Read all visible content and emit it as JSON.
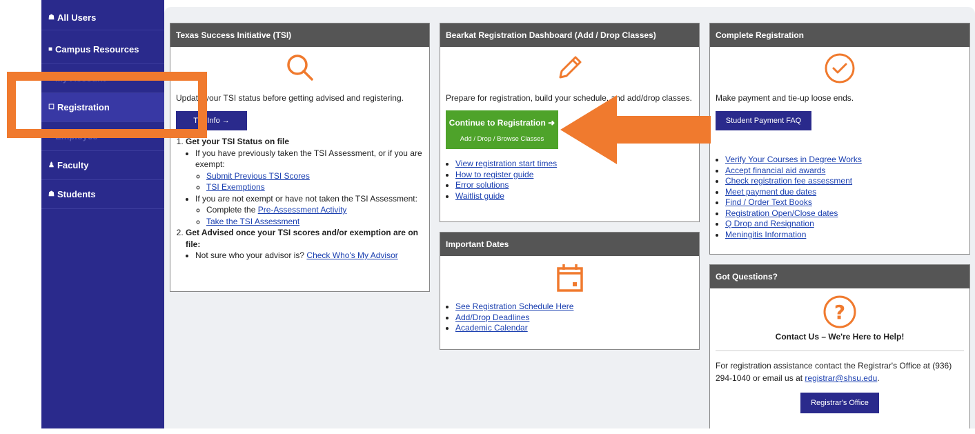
{
  "sidebar": {
    "items": [
      {
        "icon": "users-icon",
        "glyph": "☗",
        "label": "All Users"
      },
      {
        "icon": "folder-icon",
        "glyph": "■",
        "label": "Campus Resources"
      },
      {
        "icon": "user-icon",
        "glyph": "■",
        "label": "My Account"
      },
      {
        "icon": "edit-icon",
        "glyph": "☐",
        "label": "Registration"
      },
      {
        "icon": "calendar-icon",
        "glyph": "■",
        "label": "Employee"
      },
      {
        "icon": "faculty-icon",
        "glyph": "♟",
        "label": "Faculty"
      },
      {
        "icon": "students-icon",
        "glyph": "☗",
        "label": "Students"
      }
    ]
  },
  "tsi": {
    "title": "Texas Success Initiative (TSI)",
    "intro": "Update your TSI status before getting advised and registering.",
    "button": "TSI Info →",
    "step1_title": "Get your TSI Status on file",
    "step1_a": "If you have previously taken the TSI Assessment, or if you are exempt:",
    "link_submit": "Submit Previous TSI Scores",
    "link_exemptions": "TSI Exemptions",
    "step1_b": "If you are not exempt or have not taken the TSI Assessment:",
    "complete_the": "Complete the ",
    "link_pre": "Pre-Assessment Activity",
    "link_take": "Take the TSI Assessment",
    "step2_title": "Get Advised once your TSI scores and/or exemption are on file:",
    "advisor_text": "Not sure who your advisor is? ",
    "link_advisor": "Check Who's My Advisor"
  },
  "dashboard": {
    "title": "Bearkat Registration Dashboard (Add / Drop Classes)",
    "intro": "Prepare for registration, build your schedule, and add/drop classes.",
    "button_main": "Continue to Registration ➜",
    "button_sub": "Add / Drop / Browse Classes",
    "links": [
      "View registration start times",
      "How to register guide",
      "Error solutions",
      "Waitlist guide"
    ]
  },
  "dates": {
    "title": "Important Dates",
    "links": [
      "See Registration Schedule Here",
      "Add/Drop Deadlines",
      "Academic Calendar"
    ]
  },
  "complete": {
    "title": "Complete Registration",
    "intro": "Make payment and tie-up loose ends.",
    "button": "Student Payment FAQ →",
    "links": [
      "Verify Your Courses in Degree Works",
      "Accept financial aid awards",
      "Check registration fee assessment",
      "Meet payment due dates",
      "Find / Order Text Books",
      "Registration Open/Close dates",
      "Q Drop and Resignation",
      "Meningitis Information"
    ]
  },
  "questions": {
    "title": "Got Questions?",
    "heading": "Contact Us – We're Here to Help!",
    "text_before": "For registration assistance contact the Registrar's Office at (936) 294-1040 or email us at ",
    "email": "registrar@shsu.edu",
    "text_after": ".",
    "button": "Registrar's Office →"
  },
  "colors": {
    "accent_orange": "#f07a2e",
    "sidebar_navy": "#2a2a8c",
    "green_button": "#4ea32a",
    "card_header": "#555555"
  }
}
